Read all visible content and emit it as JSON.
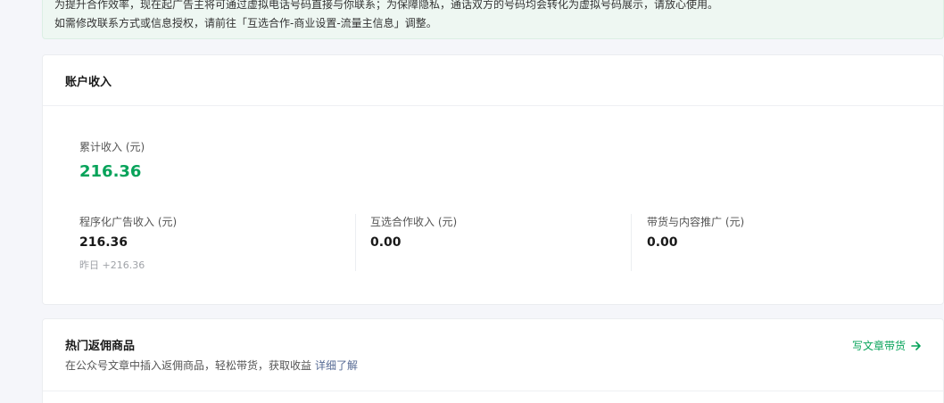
{
  "notice": {
    "line1": "为提升合作效率，现在起广告主将可通过虚拟电话号码直接与你联系；为保障隐私，通话双方的号码均会转化为虚拟号码展示，请放心使用。",
    "line2_prefix": "如需修改联系方式或信息授权，请前往",
    "line2_link": "「互选合作-商业设置-流量主信息」",
    "line2_suffix": "调整。"
  },
  "account_income": {
    "title": "账户收入",
    "total_label": "累计收入 (元)",
    "total_value": "216.36",
    "total_color": "#07a35a",
    "columns": [
      {
        "label": "程序化广告收入 (元)",
        "value": "216.36",
        "sub": "昨日 +216.36"
      },
      {
        "label": "互选合作收入 (元)",
        "value": "0.00"
      },
      {
        "label": "带货与内容推广 (元)",
        "value": "0.00"
      }
    ]
  },
  "hot_goods": {
    "title": "热门返佣商品",
    "description": "在公众号文章中插入返佣商品，轻松带货，获取收益",
    "detail_link": "详细了解",
    "write_button": "写文章带货",
    "arrow_icon": "arrow-right-icon",
    "accent_color": "#07a35a"
  }
}
